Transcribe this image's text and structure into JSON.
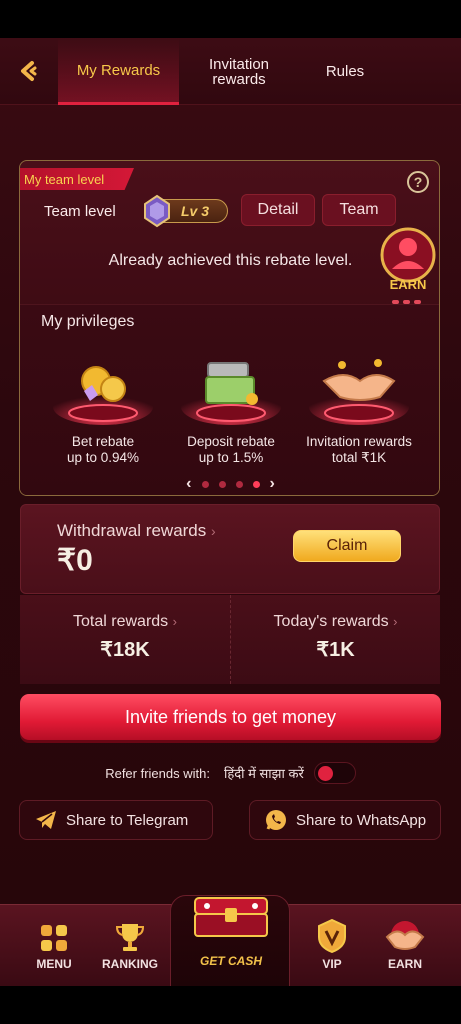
{
  "header": {
    "tabs": [
      {
        "label": "My Rewards",
        "active": true
      },
      {
        "label": "Invitation rewards",
        "label_line1": "Invitation",
        "label_line2": "rewards",
        "active": false
      },
      {
        "label": "Rules",
        "active": false
      }
    ]
  },
  "team": {
    "ribbon": "My team level",
    "level_label": "Team level",
    "level_value": "Lv 3",
    "detail_label": "Detail",
    "team_label": "Team",
    "status": "Already achieved this rebate level.",
    "earn_badge": "EARN"
  },
  "privileges": {
    "title": "My privileges",
    "items": [
      {
        "line1": "Bet rebate",
        "line2": "up to 0.94%"
      },
      {
        "line1": "Deposit rebate",
        "line2": "up to 1.5%"
      },
      {
        "line1": "Invitation rewards",
        "line2": "total ₹1K"
      }
    ],
    "active_page": 4,
    "page_count": 4
  },
  "withdrawal": {
    "label": "Withdrawal rewards",
    "amount": "₹0",
    "claim_label": "Claim"
  },
  "totals": {
    "total_label": "Total rewards",
    "total_value": "₹18K",
    "today_label": "Today's rewards",
    "today_value": "₹1K"
  },
  "invite_button": "Invite friends to get money",
  "refer": {
    "label": "Refer friends with:",
    "language": "हिंदी में साझा करें",
    "toggle_on": false
  },
  "share": {
    "telegram": "Share to Telegram",
    "whatsapp": "Share to WhatsApp"
  },
  "nav": {
    "menu": "MENU",
    "ranking": "RANKING",
    "getcash": "GET CASH",
    "vip": "VIP",
    "earn": "EARN"
  },
  "colors": {
    "accent_red": "#e0223f",
    "gold": "#f7c84a",
    "background": "#2c070d"
  }
}
